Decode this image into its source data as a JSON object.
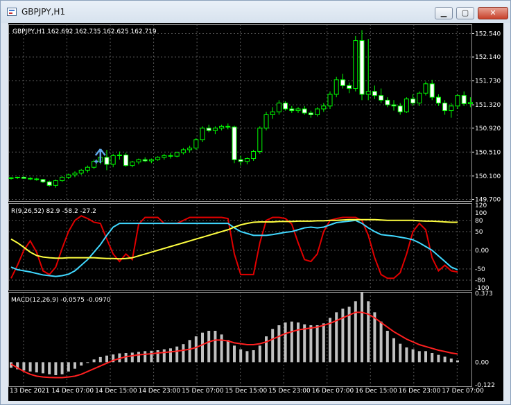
{
  "window": {
    "title": "GBPJPY,H1",
    "minimize": "▁",
    "maximize": "▢",
    "close": "✕"
  },
  "colors": {
    "bull": "#000000",
    "bear": "#ffffff",
    "wick": "#00ff00",
    "grid": "#5a5a5a",
    "rsi_fast": "#e00000",
    "rsi_mid": "#40d8ff",
    "rsi_slow": "#ffff40",
    "macd_hist": "#c0c0c0",
    "macd_signal": "#ff2020",
    "signal_arrow": "#5fa8e8"
  },
  "main": {
    "header": "GBPJPY,H1  162.692 162.735 162.625 162.719",
    "price_labels": [
      "152.540",
      "152.140",
      "151.730",
      "151.320",
      "150.920",
      "150.510",
      "150.100",
      "149.700"
    ],
    "price_levels": [
      152.54,
      152.14,
      151.73,
      151.32,
      150.92,
      150.51,
      150.1,
      149.7
    ],
    "ylim": [
      149.67,
      152.7
    ]
  },
  "rsi": {
    "label": "R(9,26,52) 82.9 -58.2 -27.2",
    "level_labels": [
      "120",
      "100",
      "80",
      "50",
      "0.00",
      "-50",
      "-80",
      "-100"
    ],
    "level_values": [
      120,
      100,
      80,
      50,
      0,
      -50,
      -80,
      -100
    ],
    "grid_levels": [
      80,
      50,
      0,
      -50,
      -80
    ],
    "ylim": [
      -106,
      126
    ]
  },
  "macd": {
    "label": "MACD(12,26,9) -0.0575 -0.0970",
    "level_labels": [
      "0.373",
      "0.00",
      "-0.122"
    ],
    "level_values": [
      0.373,
      0,
      -0.122
    ],
    "ylim": [
      -0.13,
      0.38
    ]
  },
  "time_labels": [
    "13 Dec 2021",
    "14 Dec 07:00",
    "14 Dec 15:00",
    "14 Dec 23:00",
    "15 Dec 07:00",
    "15 Dec 15:00",
    "15 Dec 23:00",
    "16 Dec 07:00",
    "16 Dec 15:00",
    "16 Dec 23:00",
    "17 Dec 07:00"
  ],
  "chart_data": [
    {
      "type": "candlestick",
      "title": "GBPJPY,H1",
      "ylim": [
        149.67,
        152.7
      ],
      "candles": [
        [
          150.06,
          150.08,
          150.04,
          150.07
        ],
        [
          150.07,
          150.09,
          150.05,
          150.08
        ],
        [
          150.08,
          150.1,
          150.05,
          150.06
        ],
        [
          150.06,
          150.08,
          150.03,
          150.05
        ],
        [
          150.05,
          150.07,
          150.02,
          150.04
        ],
        [
          150.04,
          150.05,
          149.98,
          150.0
        ],
        [
          150.0,
          150.02,
          149.92,
          149.94
        ],
        [
          149.94,
          150.04,
          149.9,
          150.02
        ],
        [
          150.02,
          150.1,
          150.0,
          150.08
        ],
        [
          150.08,
          150.14,
          150.05,
          150.12
        ],
        [
          150.12,
          150.18,
          150.08,
          150.15
        ],
        [
          150.15,
          150.22,
          150.12,
          150.2
        ],
        [
          150.2,
          150.28,
          150.16,
          150.25
        ],
        [
          150.25,
          150.38,
          150.22,
          150.35
        ],
        [
          150.35,
          150.45,
          150.3,
          150.42
        ],
        [
          150.42,
          150.55,
          150.2,
          150.3
        ],
        [
          150.3,
          150.48,
          150.25,
          150.45
        ],
        [
          150.45,
          150.52,
          150.38,
          150.46
        ],
        [
          150.46,
          150.5,
          150.26,
          150.28
        ],
        [
          150.28,
          150.36,
          150.25,
          150.34
        ],
        [
          150.34,
          150.4,
          150.3,
          150.38
        ],
        [
          150.38,
          150.42,
          150.34,
          150.36
        ],
        [
          150.36,
          150.4,
          150.32,
          150.38
        ],
        [
          150.38,
          150.44,
          150.36,
          150.42
        ],
        [
          150.42,
          150.48,
          150.38,
          150.45
        ],
        [
          150.45,
          150.5,
          150.4,
          150.44
        ],
        [
          150.44,
          150.52,
          150.42,
          150.5
        ],
        [
          150.5,
          150.58,
          150.47,
          150.55
        ],
        [
          150.55,
          150.62,
          150.5,
          150.58
        ],
        [
          150.58,
          150.75,
          150.55,
          150.72
        ],
        [
          150.72,
          150.95,
          150.68,
          150.92
        ],
        [
          150.92,
          150.98,
          150.85,
          150.88
        ],
        [
          150.88,
          150.95,
          150.82,
          150.92
        ],
        [
          150.92,
          150.98,
          150.88,
          150.95
        ],
        [
          150.95,
          151.0,
          150.9,
          150.94
        ],
        [
          150.94,
          150.96,
          150.32,
          150.38
        ],
        [
          150.38,
          150.45,
          150.28,
          150.35
        ],
        [
          150.35,
          150.42,
          150.3,
          150.4
        ],
        [
          150.4,
          150.55,
          150.36,
          150.52
        ],
        [
          150.52,
          150.95,
          150.48,
          150.92
        ],
        [
          150.92,
          151.2,
          150.88,
          151.15
        ],
        [
          151.15,
          151.28,
          151.08,
          151.2
        ],
        [
          151.2,
          151.4,
          151.15,
          151.35
        ],
        [
          151.35,
          151.38,
          151.22,
          151.25
        ],
        [
          151.25,
          151.3,
          151.18,
          151.22
        ],
        [
          151.22,
          151.28,
          151.18,
          151.25
        ],
        [
          151.25,
          151.3,
          151.15,
          151.18
        ],
        [
          151.18,
          151.22,
          151.1,
          151.15
        ],
        [
          151.15,
          151.28,
          151.12,
          151.25
        ],
        [
          151.25,
          151.35,
          151.2,
          151.3
        ],
        [
          151.3,
          151.55,
          151.25,
          151.5
        ],
        [
          151.5,
          151.8,
          151.45,
          151.75
        ],
        [
          151.75,
          151.85,
          151.6,
          151.65
        ],
        [
          151.65,
          151.7,
          151.52,
          151.6
        ],
        [
          151.6,
          152.5,
          151.55,
          152.42
        ],
        [
          152.42,
          152.6,
          151.4,
          151.5
        ],
        [
          151.5,
          152.45,
          151.4,
          151.55
        ],
        [
          151.55,
          151.65,
          151.42,
          151.48
        ],
        [
          151.48,
          151.6,
          151.35,
          151.4
        ],
        [
          151.4,
          151.45,
          151.28,
          151.32
        ],
        [
          151.32,
          151.4,
          151.22,
          151.3
        ],
        [
          151.3,
          151.35,
          151.15,
          151.2
        ],
        [
          151.2,
          151.45,
          151.18,
          151.42
        ],
        [
          151.42,
          151.5,
          151.3,
          151.35
        ],
        [
          151.35,
          151.55,
          151.3,
          151.52
        ],
        [
          151.52,
          151.72,
          151.48,
          151.68
        ],
        [
          151.68,
          151.75,
          151.4,
          151.45
        ],
        [
          151.45,
          151.5,
          151.3,
          151.35
        ],
        [
          151.35,
          151.4,
          151.15,
          151.22
        ],
        [
          151.22,
          151.35,
          151.1,
          151.3
        ],
        [
          151.3,
          151.5,
          151.25,
          151.48
        ],
        [
          151.48,
          151.55,
          151.3,
          151.34
        ],
        [
          151.34,
          151.45,
          151.28,
          151.36
        ]
      ],
      "signal_arrow_index": 14
    },
    {
      "type": "line",
      "title": "R(9,26,52) 82.9 -58.2 -27.2",
      "ylim": [
        -106,
        126
      ],
      "series": [
        {
          "name": "R(9,26,52)",
          "values": [
            -75,
            -40,
            0,
            25,
            -5,
            -55,
            -65,
            -45,
            5,
            50,
            80,
            92,
            85,
            75,
            72,
            30,
            -10,
            -30,
            -10,
            -25,
            70,
            88,
            88,
            88,
            72,
            72,
            72,
            80,
            88,
            88,
            88,
            88,
            88,
            88,
            85,
            -10,
            -65,
            -65,
            -65,
            20,
            80,
            88,
            88,
            85,
            70,
            20,
            -25,
            -30,
            -10,
            50,
            80,
            85,
            88,
            88,
            88,
            80,
            40,
            -20,
            -65,
            -75,
            -75,
            -60,
            -10,
            50,
            72,
            55,
            -20,
            -55,
            -40,
            -55,
            -58
          ]
        },
        {
          "values": [
            -45,
            -52,
            -55,
            -58,
            -62,
            -66,
            -68,
            -70,
            -68,
            -64,
            -55,
            -40,
            -25,
            -5,
            15,
            40,
            62,
            72,
            72,
            72,
            72,
            72,
            72,
            72,
            72,
            72,
            72,
            72,
            72,
            72,
            72,
            72,
            72,
            72,
            72,
            60,
            50,
            45,
            40,
            40,
            40,
            42,
            45,
            48,
            50,
            55,
            60,
            62,
            60,
            62,
            68,
            74,
            76,
            78,
            80,
            72,
            60,
            50,
            42,
            40,
            38,
            35,
            32,
            28,
            20,
            10,
            0,
            -15,
            -30,
            -45,
            -52
          ]
        },
        {
          "values": [
            30,
            20,
            8,
            -5,
            -14,
            -18,
            -20,
            -21,
            -21,
            -20,
            -20,
            -20,
            -20,
            -20,
            -21,
            -22,
            -22,
            -23,
            -22,
            -20,
            -15,
            -10,
            -5,
            0,
            5,
            10,
            15,
            20,
            25,
            30,
            35,
            40,
            45,
            50,
            55,
            62,
            68,
            72,
            75,
            76,
            76,
            76,
            77,
            77,
            77,
            78,
            78,
            78,
            79,
            79,
            80,
            80,
            81,
            82,
            82,
            82,
            82,
            82,
            81,
            80,
            80,
            80,
            80,
            80,
            79,
            78,
            78,
            77,
            76,
            75,
            75
          ]
        }
      ]
    },
    {
      "type": "bar",
      "title": "MACD(12,26,9) -0.0575 -0.0970",
      "ylim": [
        -0.13,
        0.38
      ],
      "series": [
        {
          "name": "MACD(12,26,9)",
          "values": [
            -0.03,
            -0.038,
            -0.045,
            -0.05,
            -0.055,
            -0.06,
            -0.065,
            -0.07,
            -0.065,
            -0.05,
            -0.035,
            -0.018,
            0.0,
            0.015,
            0.028,
            0.036,
            0.042,
            0.048,
            0.05,
            0.052,
            0.056,
            0.06,
            0.062,
            0.065,
            0.07,
            0.075,
            0.085,
            0.098,
            0.12,
            0.14,
            0.16,
            0.17,
            0.17,
            0.15,
            0.12,
            0.09,
            0.07,
            0.06,
            0.065,
            0.09,
            0.14,
            0.18,
            0.2,
            0.215,
            0.22,
            0.215,
            0.205,
            0.2,
            0.2,
            0.21,
            0.24,
            0.27,
            0.29,
            0.3,
            0.33,
            0.38,
            0.33,
            0.27,
            0.22,
            0.17,
            0.13,
            0.1,
            0.08,
            0.07,
            0.06,
            0.06,
            0.05,
            0.04,
            0.03,
            0.02,
            0.01
          ]
        },
        {
          "values": [
            -0.01,
            -0.03,
            -0.05,
            -0.065,
            -0.075,
            -0.08,
            -0.082,
            -0.083,
            -0.083,
            -0.08,
            -0.075,
            -0.065,
            -0.05,
            -0.035,
            -0.02,
            -0.005,
            0.01,
            0.02,
            0.03,
            0.035,
            0.04,
            0.043,
            0.046,
            0.05,
            0.053,
            0.056,
            0.06,
            0.065,
            0.07,
            0.08,
            0.095,
            0.11,
            0.12,
            0.12,
            0.115,
            0.105,
            0.1,
            0.095,
            0.095,
            0.1,
            0.11,
            0.125,
            0.14,
            0.155,
            0.165,
            0.175,
            0.18,
            0.185,
            0.19,
            0.2,
            0.21,
            0.225,
            0.24,
            0.255,
            0.27,
            0.27,
            0.26,
            0.24,
            0.215,
            0.19,
            0.165,
            0.145,
            0.125,
            0.11,
            0.095,
            0.085,
            0.075,
            0.065,
            0.058,
            0.05,
            0.045
          ]
        }
      ]
    }
  ]
}
